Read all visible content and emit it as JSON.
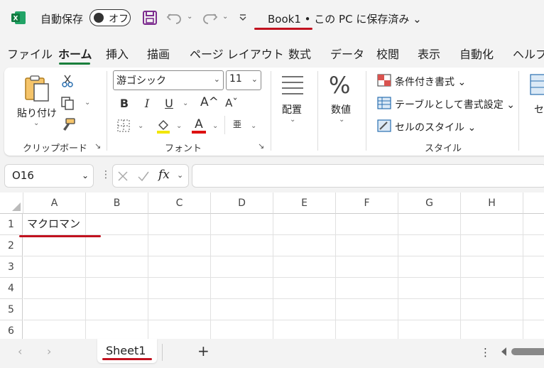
{
  "titlebar": {
    "autosave_label": "自動保存",
    "autosave_state": "オフ",
    "more_glyph": "⌄",
    "title": "Book1 • この PC に保存済み ⌄"
  },
  "tabs": [
    "ファイル",
    "ホーム",
    "挿入",
    "描画",
    "ページ レイアウト",
    "数式",
    "データ",
    "校閲",
    "表示",
    "自動化",
    "ヘルプ"
  ],
  "ribbon": {
    "clipboard": {
      "paste": "貼り付け",
      "label": "クリップボード"
    },
    "font": {
      "name": "游ゴシック",
      "size": "11",
      "label": "フォント",
      "bold": "B",
      "italic": "I",
      "underline": "U",
      "grow": "A^",
      "shrink": "Aˇ",
      "font_color": "A",
      "phonetic": "亜"
    },
    "alignment": {
      "label": "配置"
    },
    "number": {
      "label": "数値",
      "symbol": "%"
    },
    "styles": {
      "conditional": "条件付き書式 ⌄",
      "table": "テーブルとして書式設定 ⌄",
      "cell_styles": "セルのスタイル ⌄",
      "label": "スタイル"
    },
    "cells_partial": "セ"
  },
  "formula_bar": {
    "name_box": "O16",
    "fx": "fx",
    "value": ""
  },
  "grid": {
    "columns": [
      "A",
      "B",
      "C",
      "D",
      "E",
      "F",
      "G",
      "H"
    ],
    "rows": [
      "1",
      "2",
      "3",
      "4",
      "5",
      "6"
    ],
    "cells": {
      "A1": "マクロマン"
    }
  },
  "sheets": {
    "tabs": [
      "Sheet1"
    ],
    "add": "+"
  },
  "colors": {
    "excel_green": "#1a7f3c",
    "annotation_red": "#c1121f",
    "save_purple": "#7d2c8f"
  }
}
